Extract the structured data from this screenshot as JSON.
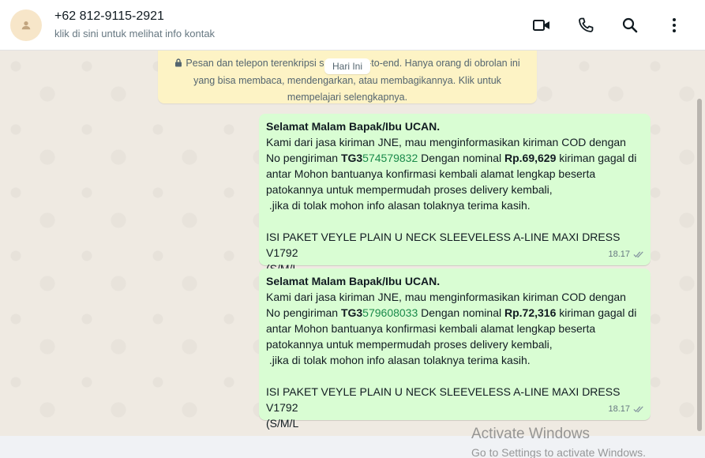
{
  "header": {
    "contact_name": "+62 812-9115-2921",
    "contact_subtitle": "klik di sini untuk melihat info kontak",
    "icons": [
      "person-icon",
      "video-call-icon",
      "voice-call-icon",
      "search-icon",
      "menu-icon"
    ]
  },
  "chat": {
    "encryption_notice": "Pesan dan telepon terenkripsi secara end-to-end. Hanya orang di obrolan ini yang bisa membaca, mendengarkan, atau membagikannya. Klik untuk mempelajari selengkapnya.",
    "day_label": "Hari Ini",
    "messages": [
      {
        "greeting": "Selamat Malam Bapak/Ibu UCAN.",
        "line1": "Kami dari jasa kiriman JNE, mau menginformasikan kiriman COD dengan",
        "line2_a": "No pengiriman ",
        "tracking_prefix": "TG3",
        "tracking_number": "574579832",
        "line2_b": " Dengan nominal ",
        "amount": "Rp.69,629",
        "line2_c": " kiriman gagal di",
        "line3": "antar Mohon bantuanya konfirmasi kembali alamat lengkap beserta",
        "line4": "patokannya untuk mempermudah proses delivery kembali,",
        "line5": " .jika di tolak mohon info alasan tolaknya terima kasih.",
        "line6": "ISI PAKET VEYLE PLAIN U NECK SLEEVELESS A-LINE MAXI DRESS V1792",
        "line7": "(S/M/L",
        "time": "18.17"
      },
      {
        "greeting": "Selamat Malam Bapak/Ibu UCAN.",
        "line1": "Kami dari jasa kiriman JNE, mau menginformasikan kiriman COD dengan",
        "line2_a": "No pengiriman ",
        "tracking_prefix": "TG3",
        "tracking_number": "579608033",
        "line2_b": " Dengan nominal ",
        "amount": "Rp.72,316",
        "line2_c": " kiriman gagal di",
        "line3": "antar Mohon bantuanya konfirmasi kembali alamat lengkap beserta",
        "line4": "patokannya untuk mempermudah proses delivery kembali,",
        "line5": " .jika di tolak mohon info alasan tolaknya terima kasih.",
        "line6": "ISI PAKET VEYLE PLAIN U NECK SLEEVELESS A-LINE MAXI DRESS V1792",
        "line7": "(S/M/L",
        "time": "18.17"
      }
    ]
  },
  "watermark": {
    "title": "Activate Windows",
    "subtitle": "Go to Settings to activate Windows."
  }
}
